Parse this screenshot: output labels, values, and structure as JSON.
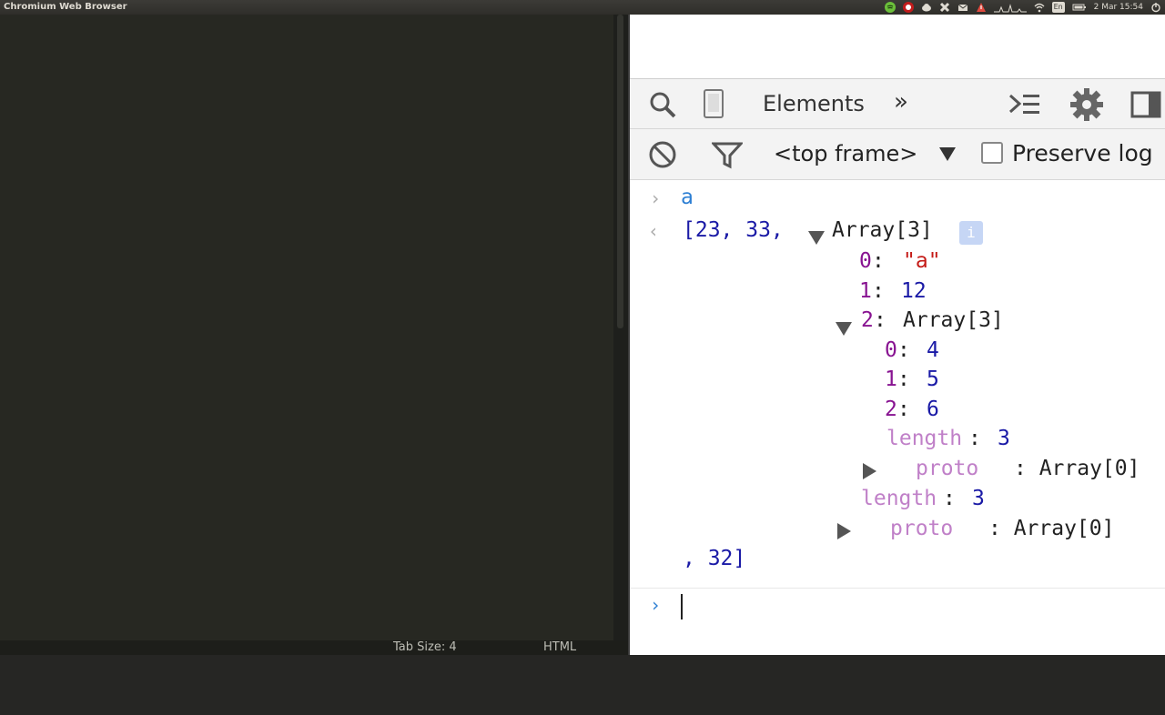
{
  "os_bar": {
    "app_title": "Chromium Web Browser",
    "clock": "2 Mar 15:54",
    "tray_icons": [
      "spotify-icon",
      "record-icon",
      "cloud-icon",
      "puzzle-icon",
      "mail-icon",
      "warning-icon",
      "network-graph-icon",
      "wifi-icon",
      "keyboard-layout-icon",
      "battery-icon",
      "power-icon"
    ],
    "keyboard_layout": "En"
  },
  "editor": {
    "status": {
      "tab_size": "Tab Size: 4",
      "syntax": "HTML"
    },
    "bg_color": "#272822"
  },
  "devtools": {
    "toolbar": {
      "tab_label": "Elements",
      "more_label": "»"
    },
    "console_toolbar": {
      "frame_label": "<top frame>",
      "preserve_log_label": "Preserve log",
      "preserve_log_checked": false
    },
    "console": {
      "input_command": "a",
      "result_open": "[23, 33, ",
      "array3_label": "Array[3]",
      "info_badge": "i",
      "item0_key": "0",
      "item0_val": "\"a\"",
      "item1_key": "1",
      "item1_val": "12",
      "item2_key": "2",
      "item2_label": "Array[3]",
      "sub0_key": "0",
      "sub0_val": "4",
      "sub1_key": "1",
      "sub1_val": "5",
      "sub2_key": "2",
      "sub2_val": "6",
      "sub_length_key": "length",
      "sub_length_val": "3",
      "sub_proto_key": "proto",
      "sub_proto_val": ": Array[0]",
      "length_key": "length",
      "length_val": "3",
      "proto_key": "proto",
      "proto_val": ": Array[0]",
      "result_close": ", 32]"
    }
  }
}
